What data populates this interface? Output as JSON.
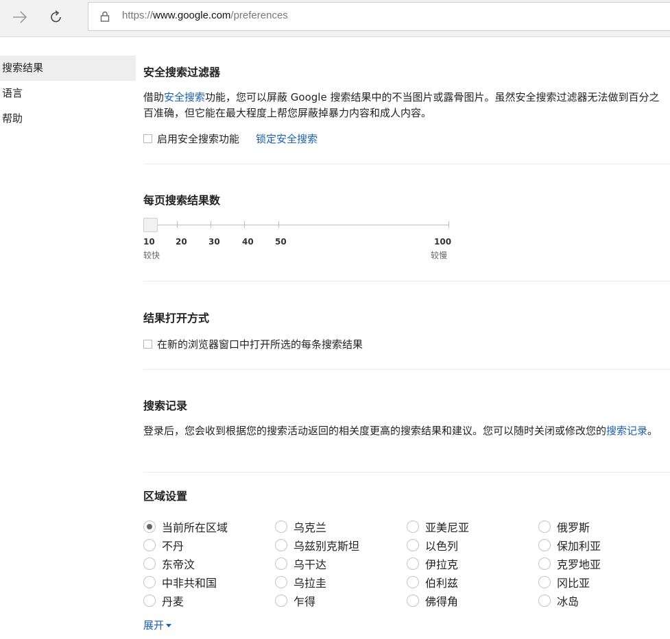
{
  "browser": {
    "url_scheme": "https://",
    "url_host": "www.google.com",
    "url_path": "/preferences"
  },
  "sidebar": {
    "items": [
      {
        "label": "搜索结果",
        "active": true
      },
      {
        "label": "语言",
        "active": false
      },
      {
        "label": "帮助",
        "active": false
      }
    ]
  },
  "safesearch": {
    "title": "安全搜索过滤器",
    "desc_pre": "借助",
    "desc_link": "安全搜索",
    "desc_post": "功能，您可以屏蔽 Google 搜索结果中的不当图片或露骨图片。虽然安全搜索过滤器无法做到百分之百准确，但它能在最大程度上帮您屏蔽掉暴力内容和成人内容。",
    "checkbox_label": "启用安全搜索功能",
    "checked": false,
    "lock_link": "锁定安全搜索"
  },
  "results_per_page": {
    "title": "每页搜索结果数",
    "value": 10,
    "ticks": [
      "10",
      "20",
      "30",
      "40",
      "50",
      "100"
    ],
    "min_label": "较快",
    "max_label": "较慢"
  },
  "open_results": {
    "title": "结果打开方式",
    "checkbox_label": "在新的浏览器窗口中打开所选的每条搜索结果",
    "checked": false
  },
  "history": {
    "title": "搜索记录",
    "desc_pre": "登录后，您会收到根据您的搜索活动返回的相关度更高的搜索结果和建议。您可以随时关闭或修改您的",
    "desc_link": "搜索记录",
    "desc_post": "。"
  },
  "region": {
    "title": "区域设置",
    "selected": "当前所在区域",
    "rows": [
      [
        "当前所在区域",
        "乌克兰",
        "亚美尼亚",
        "俄罗斯"
      ],
      [
        "不丹",
        "乌兹别克斯坦",
        "以色列",
        "保加利亚"
      ],
      [
        "东帝汶",
        "乌干达",
        "伊拉克",
        "克罗地亚"
      ],
      [
        "中非共和国",
        "乌拉圭",
        "伯利兹",
        "冈比亚"
      ],
      [
        "丹麦",
        "乍得",
        "佛得角",
        "冰岛"
      ]
    ],
    "expand_label": "展开"
  },
  "icons": {
    "forward": "arrow-right-icon",
    "reload": "reload-icon",
    "lock": "lock-icon",
    "expand": "caret-down-icon"
  },
  "colors": {
    "link": "#1a5fb4",
    "toolbar_bg": "#f2f2f2",
    "sidebar_active_bg": "#eeeeee"
  }
}
